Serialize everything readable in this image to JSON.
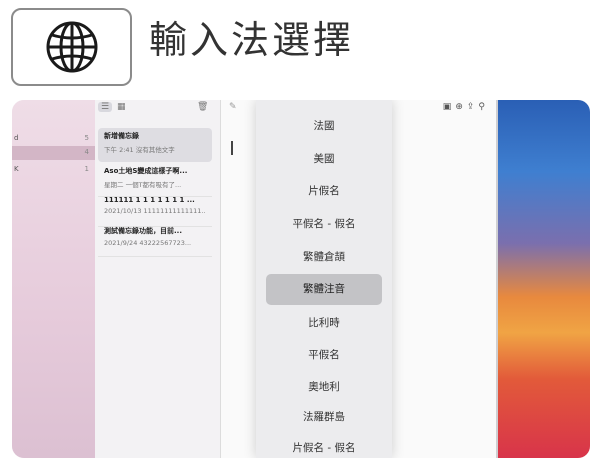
{
  "header": {
    "title": "輸入法選擇",
    "globe_icon": "globe-icon"
  },
  "sidebar": {
    "folders": [
      {
        "name": "d",
        "count": "5"
      },
      {
        "name": "",
        "count": "4"
      },
      {
        "name": "K",
        "count": "1"
      }
    ]
  },
  "notes": [
    {
      "title": "新增備忘錄",
      "meta": "下午 2:41  沒有其他文字"
    },
    {
      "title": "Aso土地S變成這樣子啊...",
      "meta": "星期二  一個T都有吸有了..."
    },
    {
      "title": "111111 1 1 1 1 1 1 1 ...",
      "meta": "2021/10/13  11111111111111..."
    },
    {
      "title": "測試備忘錄功能，目前...",
      "meta": "2021/9/24  43222567723..."
    }
  ],
  "menu": {
    "items": [
      "法國",
      "美國",
      "片假名",
      "平假名 - 假名",
      "繁體倉頡",
      "繁體注音",
      "比利時",
      "平假名",
      "奧地利",
      "法羅群島",
      "片假名 - 假名"
    ],
    "selected_index": 5
  },
  "colors": {
    "accent_selected": "#c3c3c6",
    "wallpaper_blue": "#2a5fb5",
    "wallpaper_orange": "#e8893e",
    "wallpaper_red": "#d8344a"
  }
}
